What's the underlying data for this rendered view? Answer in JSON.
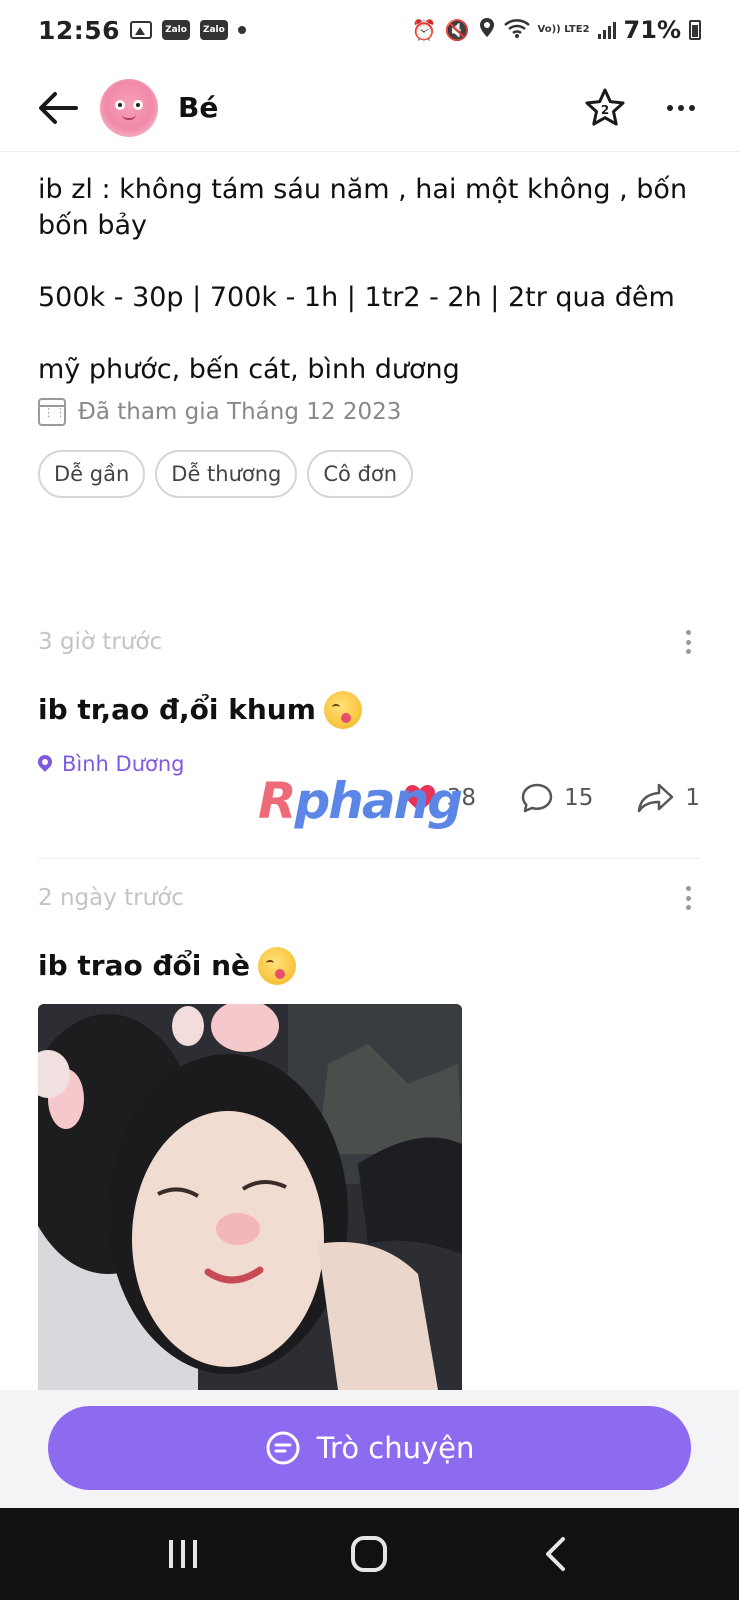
{
  "status_bar": {
    "time": "12:56",
    "notif_zalo_1": "Zalo",
    "notif_zalo_2": "Zalo",
    "lte": "Vo)) LTE2",
    "battery": "71%"
  },
  "header": {
    "title": "Bé",
    "back_icon": "arrow-left-icon",
    "star_icon": "star-icon",
    "more_icon": "more-dots-icon"
  },
  "bio": {
    "line1": "ib zl : không tám sáu năm , hai một không , bốn bốn bảy",
    "line2": "500k - 30p | 700k - 1h | 1tr2 - 2h | 2tr qua đêm",
    "line3": "mỹ phước, bến cát, bình dương",
    "joined": "Đã tham gia Tháng 12 2023",
    "tags": [
      "Dễ gần",
      "Dễ thương",
      "Cô đơn"
    ]
  },
  "posts": [
    {
      "time": "3 giờ trước",
      "text": "ib tr,ao đ,ổi khum",
      "location": "Bình Dương",
      "likes": "38",
      "comments": "15",
      "shares": "1"
    },
    {
      "time": "2 ngày trước",
      "text": "ib trao đổi nè"
    }
  ],
  "watermark": {
    "r": "R",
    "rest": "phang"
  },
  "chat_button": {
    "label": "Trò chuyện"
  },
  "colors": {
    "accent": "#8d6bf0",
    "location": "#7f5ae0",
    "like": "#e8345a"
  }
}
